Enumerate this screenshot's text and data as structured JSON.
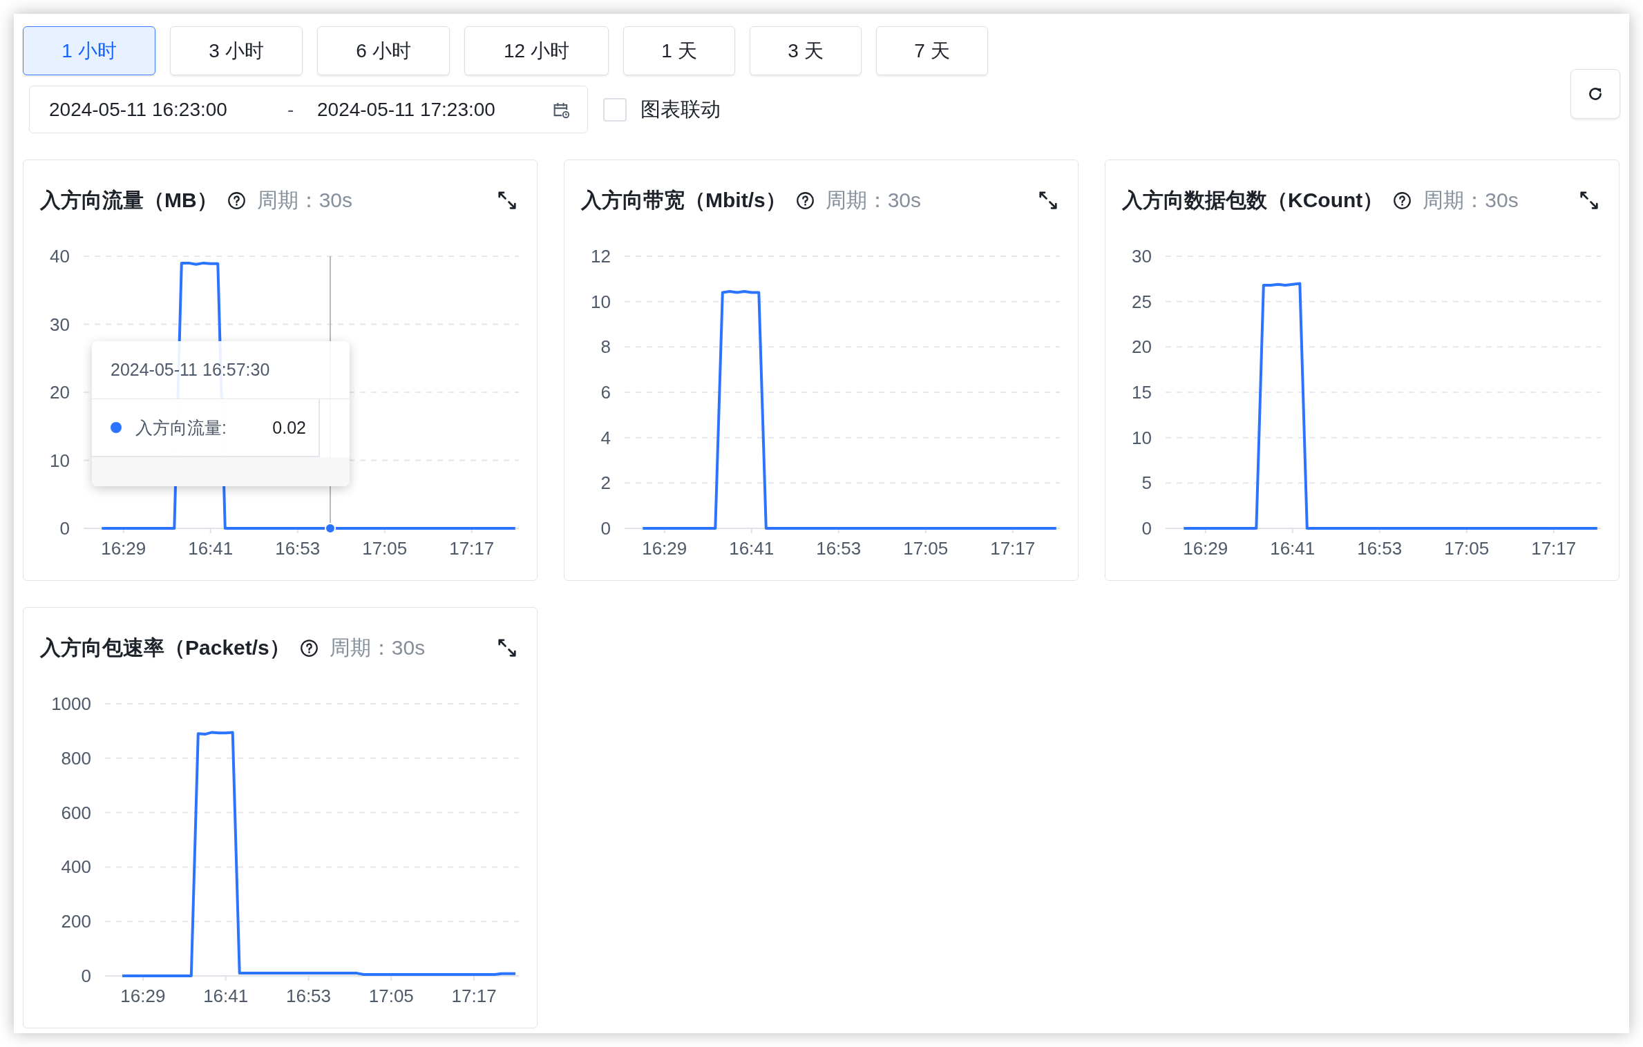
{
  "time_ranges": [
    {
      "label": "1 小时",
      "selected": true
    },
    {
      "label": "3 小时",
      "selected": false
    },
    {
      "label": "6 小时",
      "selected": false
    },
    {
      "label": "12 小时",
      "selected": false
    },
    {
      "label": "1 天",
      "selected": false
    },
    {
      "label": "3 天",
      "selected": false
    },
    {
      "label": "7 天",
      "selected": false
    }
  ],
  "date_range": {
    "start": "2024-05-11 16:23:00",
    "separator": "-",
    "end": "2024-05-11 17:23:00"
  },
  "link_charts": {
    "label": "图表联动",
    "checked": false
  },
  "charts": [
    {
      "title": "入方向流量（MB）",
      "period": "周期：30s",
      "tooltip": {
        "time": "2024-05-11 16:57:30",
        "label": "入方向流量:",
        "value": "0.02"
      },
      "chart_data": {
        "type": "line",
        "categories": [
          null,
          null,
          null,
          "16:29",
          null,
          null,
          null,
          null,
          null,
          null,
          null,
          null,
          null,
          null,
          null,
          "16:41",
          null,
          null,
          null,
          null,
          null,
          null,
          null,
          null,
          null,
          null,
          null,
          "16:53",
          null,
          null,
          null,
          null,
          null,
          null,
          null,
          null,
          null,
          null,
          null,
          "17:05",
          null,
          null,
          null,
          null,
          null,
          null,
          null,
          null,
          null,
          null,
          null,
          "17:17",
          null,
          null,
          null,
          null,
          null,
          null
        ],
        "series": [
          {
            "color": "#2b74ff",
            "values": [
              0,
              0,
              0,
              0,
              0,
              0,
              0,
              0,
              0,
              0,
              0,
              39,
              39,
              38.8,
              39,
              38.9,
              38.9,
              0,
              0,
              0,
              0,
              0,
              0,
              0,
              0,
              0,
              0,
              0,
              0,
              0,
              0,
              0,
              0,
              0,
              0,
              0,
              0,
              0,
              0,
              0,
              0,
              0,
              0,
              0,
              0,
              0,
              0,
              0,
              0,
              0,
              0,
              0,
              0,
              0,
              0,
              0,
              0,
              0
            ]
          }
        ],
        "ylim": [
          0,
          40
        ],
        "yticks": [
          0,
          10,
          20,
          30,
          40
        ],
        "grid": true
      }
    },
    {
      "title": "入方向带宽（Mbit/s）",
      "period": "周期：30s",
      "chart_data": {
        "type": "line",
        "categories": [
          null,
          null,
          null,
          "16:29",
          null,
          null,
          null,
          null,
          null,
          null,
          null,
          null,
          null,
          null,
          null,
          "16:41",
          null,
          null,
          null,
          null,
          null,
          null,
          null,
          null,
          null,
          null,
          null,
          "16:53",
          null,
          null,
          null,
          null,
          null,
          null,
          null,
          null,
          null,
          null,
          null,
          "17:05",
          null,
          null,
          null,
          null,
          null,
          null,
          null,
          null,
          null,
          null,
          null,
          "17:17",
          null,
          null,
          null,
          null,
          null,
          null
        ],
        "series": [
          {
            "color": "#2b74ff",
            "values": [
              0,
              0,
              0,
              0,
              0,
              0,
              0,
              0,
              0,
              0,
              0,
              10.4,
              10.45,
              10.4,
              10.45,
              10.4,
              10.4,
              0,
              0,
              0,
              0,
              0,
              0,
              0,
              0,
              0,
              0,
              0,
              0,
              0,
              0,
              0,
              0,
              0,
              0,
              0,
              0,
              0,
              0,
              0,
              0,
              0,
              0,
              0,
              0,
              0,
              0,
              0,
              0,
              0,
              0,
              0,
              0,
              0,
              0,
              0,
              0,
              0
            ]
          }
        ],
        "ylim": [
          0,
          12
        ],
        "yticks": [
          0,
          2,
          4,
          6,
          8,
          10,
          12
        ],
        "grid": true
      }
    },
    {
      "title": "入方向数据包数（KCount）",
      "period": "周期：30s",
      "chart_data": {
        "type": "line",
        "categories": [
          null,
          null,
          null,
          "16:29",
          null,
          null,
          null,
          null,
          null,
          null,
          null,
          null,
          null,
          null,
          null,
          "16:41",
          null,
          null,
          null,
          null,
          null,
          null,
          null,
          null,
          null,
          null,
          null,
          "16:53",
          null,
          null,
          null,
          null,
          null,
          null,
          null,
          null,
          null,
          null,
          null,
          "17:05",
          null,
          null,
          null,
          null,
          null,
          null,
          null,
          null,
          null,
          null,
          null,
          "17:17",
          null,
          null,
          null,
          null,
          null,
          null
        ],
        "series": [
          {
            "color": "#2b74ff",
            "values": [
              0,
              0,
              0,
              0,
              0,
              0,
              0,
              0,
              0,
              0,
              0,
              26.8,
              26.8,
              26.9,
              26.8,
              26.9,
              27,
              0,
              0,
              0,
              0,
              0,
              0,
              0,
              0,
              0,
              0,
              0,
              0,
              0,
              0,
              0,
              0,
              0,
              0,
              0,
              0,
              0,
              0,
              0,
              0,
              0,
              0,
              0,
              0,
              0,
              0,
              0,
              0,
              0,
              0,
              0,
              0,
              0,
              0,
              0,
              0,
              0
            ]
          }
        ],
        "ylim": [
          0,
          30
        ],
        "yticks": [
          0,
          5,
          10,
          15,
          20,
          25,
          30
        ],
        "grid": true
      }
    },
    {
      "title": "入方向包速率（Packet/s）",
      "period": "周期：30s",
      "chart_data": {
        "type": "line",
        "categories": [
          null,
          null,
          null,
          "16:29",
          null,
          null,
          null,
          null,
          null,
          null,
          null,
          null,
          null,
          null,
          null,
          "16:41",
          null,
          null,
          null,
          null,
          null,
          null,
          null,
          null,
          null,
          null,
          null,
          "16:53",
          null,
          null,
          null,
          null,
          null,
          null,
          null,
          null,
          null,
          null,
          null,
          "17:05",
          null,
          null,
          null,
          null,
          null,
          null,
          null,
          null,
          null,
          null,
          null,
          "17:17",
          null,
          null,
          null,
          null,
          null,
          null
        ],
        "series": [
          {
            "color": "#2b74ff",
            "values": [
              0,
              0,
              0,
              0,
              0,
              0,
              0,
              0,
              0,
              0,
              0,
              890,
              888,
              895,
              893,
              893,
              895,
              10,
              10,
              10,
              10,
              10,
              10,
              10,
              10,
              10,
              10,
              10,
              10,
              10,
              10,
              10,
              10,
              10,
              10,
              5,
              5,
              5,
              5,
              5,
              5,
              5,
              5,
              5,
              5,
              5,
              5,
              5,
              5,
              5,
              5,
              5,
              5,
              5,
              5,
              8,
              8,
              8
            ]
          }
        ],
        "ylim": [
          0,
          1000
        ],
        "yticks": [
          0,
          200,
          400,
          600,
          800,
          1000
        ],
        "grid": true
      }
    }
  ]
}
